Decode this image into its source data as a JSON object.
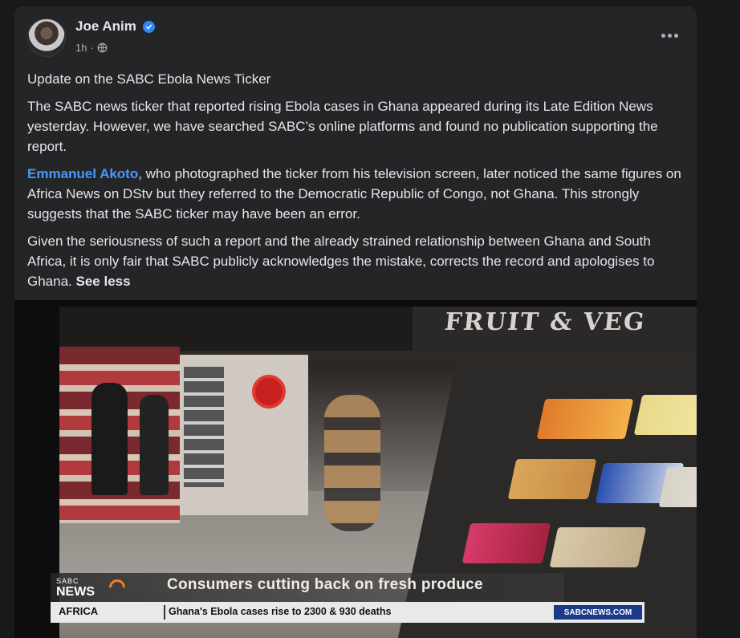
{
  "post": {
    "author": "Joe Anim",
    "time": "1h",
    "visibility_icon": "globe-icon",
    "verified_icon": "verified-badge-icon",
    "more_icon": "more-options-icon",
    "title": "Update on the SABC Ebola News Ticker",
    "paragraph1": "The SABC news ticker that reported rising Ebola cases in Ghana appeared during its Late Edition News yesterday. However, we have searched SABC’s online platforms and found no publication supporting the report.",
    "mention": "Emmanuel Akoto",
    "paragraph2_rest": ", who photographed the ticker from his television screen, later noticed the same figures on Africa News on DStv but they referred to the Democratic Republic of Congo, not Ghana. This strongly suggests that the SABC ticker may have been an error.",
    "paragraph3": "Given the seriousness of such a report and the already strained relationship between Ghana and South Africa, it is only fair that SABC publicly acknowledges the mistake, corrects the record and apologises to Ghana.",
    "see_less": "See less"
  },
  "photo": {
    "store_sign": "FRUIT & VEG",
    "logo_small": "SABC",
    "logo_news": "NEWS",
    "headline": "Consumers cutting back on fresh produce",
    "region": "AFRICA",
    "ticker": "Ghana's Ebola cases rise to 2300 & 930 deaths",
    "website": "SABCNEWS.COM"
  },
  "colors": {
    "background": "#18191a",
    "card": "#242526",
    "text": "#e4e6eb",
    "secondary_text": "#b0b3b8",
    "link": "#4599ff",
    "verified": "#2d88ff"
  }
}
